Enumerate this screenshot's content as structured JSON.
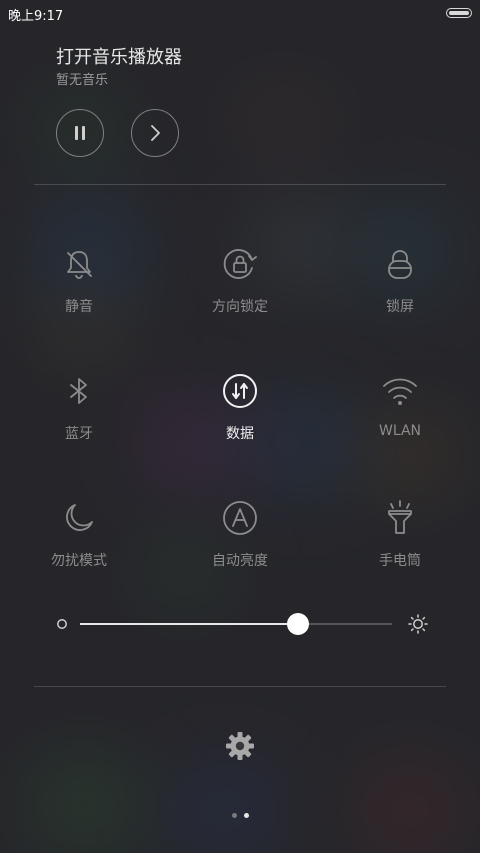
{
  "status_bar": {
    "time": "晚上9:17",
    "battery_icon": "battery-icon"
  },
  "music": {
    "title": "打开音乐播放器",
    "subtitle": "暂无音乐",
    "pause_icon": "pause-icon",
    "next_icon": "next-icon"
  },
  "toggles": [
    {
      "label": "静音",
      "icon": "mute-bell-icon",
      "active": false
    },
    {
      "label": "方向锁定",
      "icon": "rotation-lock-icon",
      "active": false
    },
    {
      "label": "锁屏",
      "icon": "lock-icon",
      "active": false
    },
    {
      "label": "蓝牙",
      "icon": "bluetooth-icon",
      "active": false
    },
    {
      "label": "数据",
      "icon": "mobile-data-icon",
      "active": true
    },
    {
      "label": "WLAN",
      "icon": "wifi-icon",
      "active": false
    },
    {
      "label": "勿扰模式",
      "icon": "moon-icon",
      "active": false
    },
    {
      "label": "自动亮度",
      "icon": "auto-brightness-icon",
      "active": false
    },
    {
      "label": "手电筒",
      "icon": "flashlight-icon",
      "active": false
    }
  ],
  "brightness": {
    "level": 0.7,
    "min_icon": "brightness-low-icon",
    "max_icon": "brightness-high-icon"
  },
  "settings_icon": "gear-icon",
  "pager": {
    "count": 2,
    "active_index": 1
  },
  "colors": {
    "inactive": "#8c8c8c",
    "active": "#f0f0f0"
  }
}
